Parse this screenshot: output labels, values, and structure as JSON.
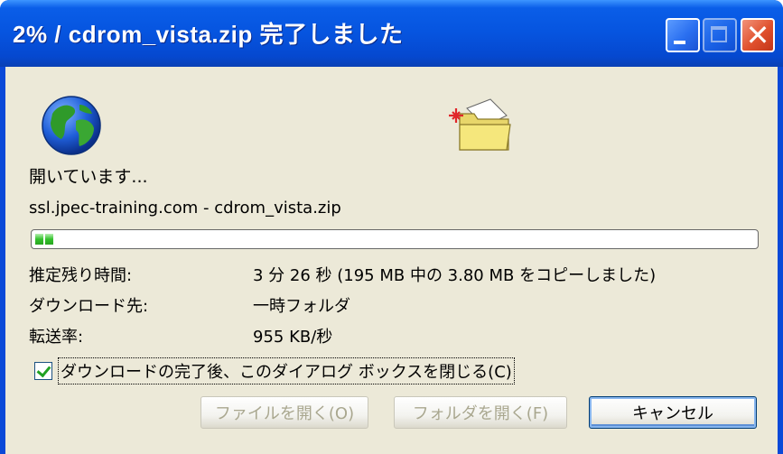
{
  "window": {
    "title": "2% / cdrom_vista.zip 完了しました",
    "close_glyph": "✕"
  },
  "status_text": "開いています...",
  "source_text": "ssl.jpec-training.com - cdrom_vista.zip",
  "progress": {
    "percent": 2,
    "segments": 2
  },
  "info": {
    "remaining_label": "推定残り時間:",
    "remaining_value": "3 分 26 秒 (195 MB 中の 3.80 MB をコピーしました)",
    "destination_label": "ダウンロード先:",
    "destination_value": "一時フォルダ",
    "rate_label": "転送率:",
    "rate_value": "955 KB/秒"
  },
  "checkbox": {
    "label": "ダウンロードの完了後、このダイアログ ボックスを閉じる(C)",
    "checked": true
  },
  "buttons": {
    "open_file": "ファイルを開く(O)",
    "open_folder": "フォルダを開く(F)",
    "cancel": "キャンセル"
  },
  "colors": {
    "titlebar": "#0654df",
    "client_bg": "#ece9d8",
    "progress_fill": "#33c12c",
    "close_button": "#e0502d"
  },
  "icons": {
    "globe": "globe-icon",
    "folder": "folder-icon"
  }
}
